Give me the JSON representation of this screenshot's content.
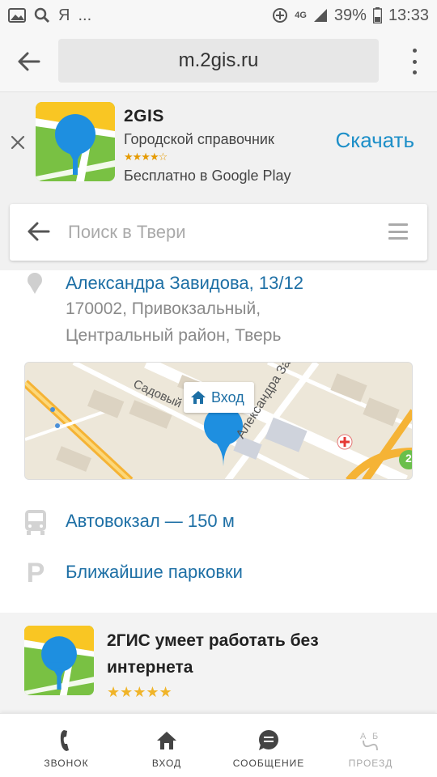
{
  "status_bar": {
    "carrier_glyph": "Я",
    "more": "...",
    "network": "4G",
    "battery": "39%",
    "time": "13:33"
  },
  "browser": {
    "url": "m.2gis.ru"
  },
  "app_banner": {
    "title": "2GIS",
    "subtitle": "Городской справочник",
    "rating_stars": "★★★★☆",
    "store": "Бесплатно в Google Play",
    "download_label": "Скачать"
  },
  "search": {
    "placeholder": "Поиск в Твери"
  },
  "address": {
    "street": "Александра Завидова, 13/12",
    "line1": "170002, Привокзальный,",
    "line2": "Центральный район, Тверь"
  },
  "map": {
    "entrance_label": "Вход",
    "street_label_1": "Садовый",
    "street_label_2": "Александра За",
    "badge": "2"
  },
  "info": {
    "bus_stop": "Автовокзал — 150 м",
    "parking": "Ближайшие парковки",
    "parking_glyph": "P"
  },
  "promo": {
    "title": "2ГИС умеет работать без интернета",
    "stars": "★★★★★"
  },
  "bottom_nav": {
    "call": "ЗВОНОК",
    "entrance": "ВХОД",
    "message": "СООБЩЕНИЕ",
    "route": "ПРОЕЗД"
  },
  "colors": {
    "link": "#1d6fa5",
    "download": "#1d8fc8",
    "logo_blue": "#1e8fe0",
    "logo_green": "#8cc63f",
    "logo_yellow": "#f9c623"
  }
}
